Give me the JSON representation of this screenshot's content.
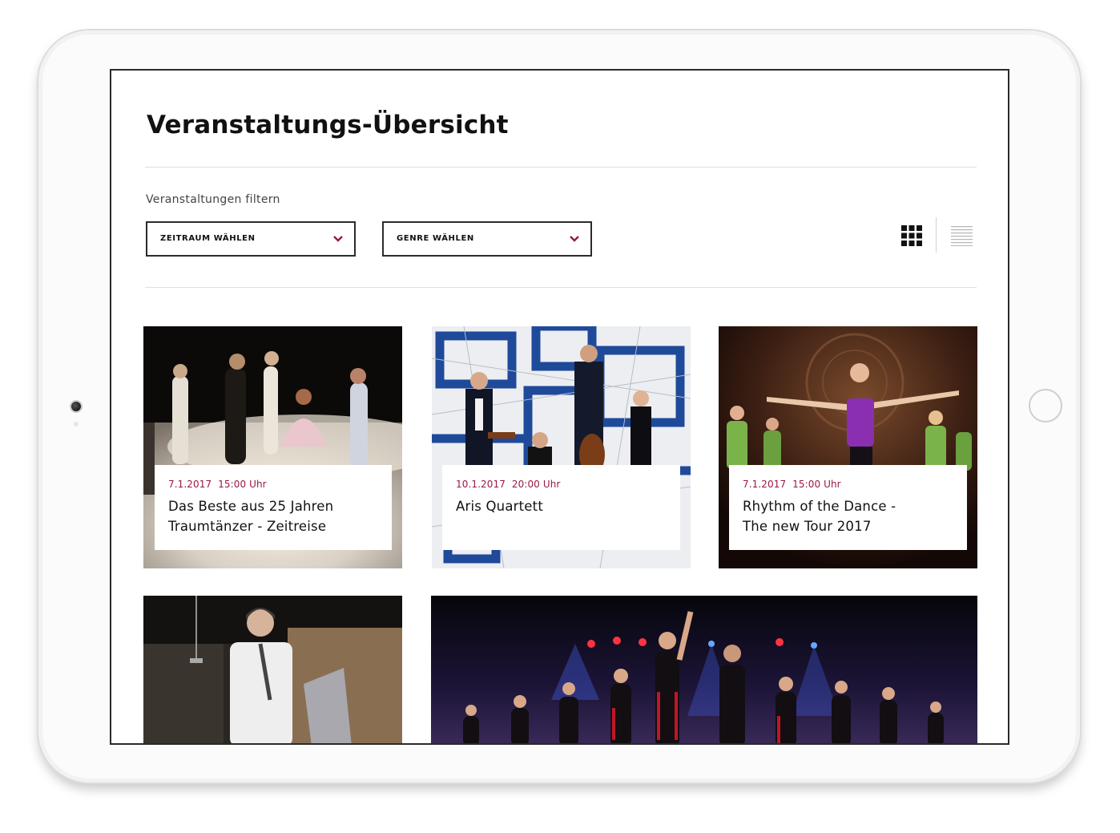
{
  "page": {
    "title": "Veranstaltungs-Übersicht",
    "filter_label": "Veranstaltungen filtern"
  },
  "filters": {
    "period_label": "ZEITRAUM WÄHLEN",
    "genre_label": "GENRE WÄHLEN"
  },
  "view_toggle": {
    "grid_icon": "grid-view-icon",
    "list_icon": "list-view-icon",
    "active": "grid"
  },
  "colors": {
    "accent": "#9b1747",
    "border": "#2b2b2b",
    "divider": "#dedede"
  },
  "events": [
    {
      "date": "7.1.2017",
      "time": "15:00 Uhr",
      "title_line1": "Das Beste aus 25 Jahren",
      "title_line2": "Traumtänzer - Zeitreise"
    },
    {
      "date": "10.1.2017",
      "time": "20:00 Uhr",
      "title_line1": "Aris Quartett",
      "title_line2": ""
    },
    {
      "date": "7.1.2017",
      "time": "15:00 Uhr",
      "title_line1": "Rhythm of the Dance -",
      "title_line2": "The new Tour 2017"
    }
  ]
}
